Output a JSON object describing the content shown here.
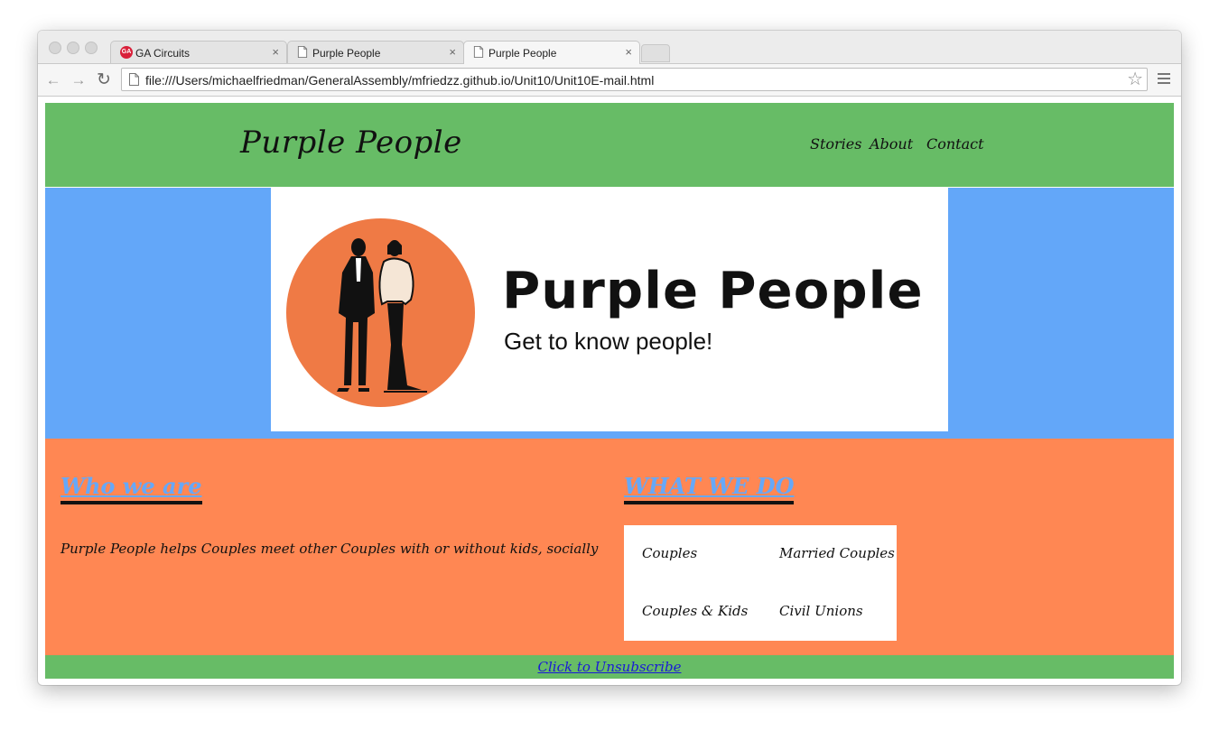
{
  "browser": {
    "tabs": [
      {
        "title": "GA Circuits",
        "close": "×"
      },
      {
        "title": "Purple People",
        "close": "×"
      },
      {
        "title": "Purple People",
        "close": "×"
      }
    ],
    "favicon_text": "GA",
    "url": "file:///Users/michaelfriedman/GeneralAssembly/mfriedzz.github.io/Unit10/Unit10E-mail.html",
    "nav_icons": {
      "back": "←",
      "forward": "→",
      "reload": "↻",
      "star": "☆"
    }
  },
  "site": {
    "brand": "Purple People",
    "nav": [
      "Stories",
      "About",
      "Contact"
    ],
    "banner": {
      "title": "Purple People",
      "subtitle": "Get to know people!"
    },
    "who": {
      "title": "Who we are",
      "text": "Purple People helps Couples meet other Couples with or without kids, socially"
    },
    "what": {
      "title": "WHAT WE DO",
      "items": [
        "Couples",
        "Married Couples",
        "Couples & Kids",
        "Civil Unions"
      ]
    },
    "footer_link": "Click to Unsubscribe"
  },
  "colors": {
    "header_green": "#67bc66",
    "hero_blue": "#63a7f9",
    "content_orange": "#ff8753",
    "circle_orange": "#ef7a45",
    "heading_blue": "#66a8f8",
    "link_blue": "#1a1ad6"
  }
}
